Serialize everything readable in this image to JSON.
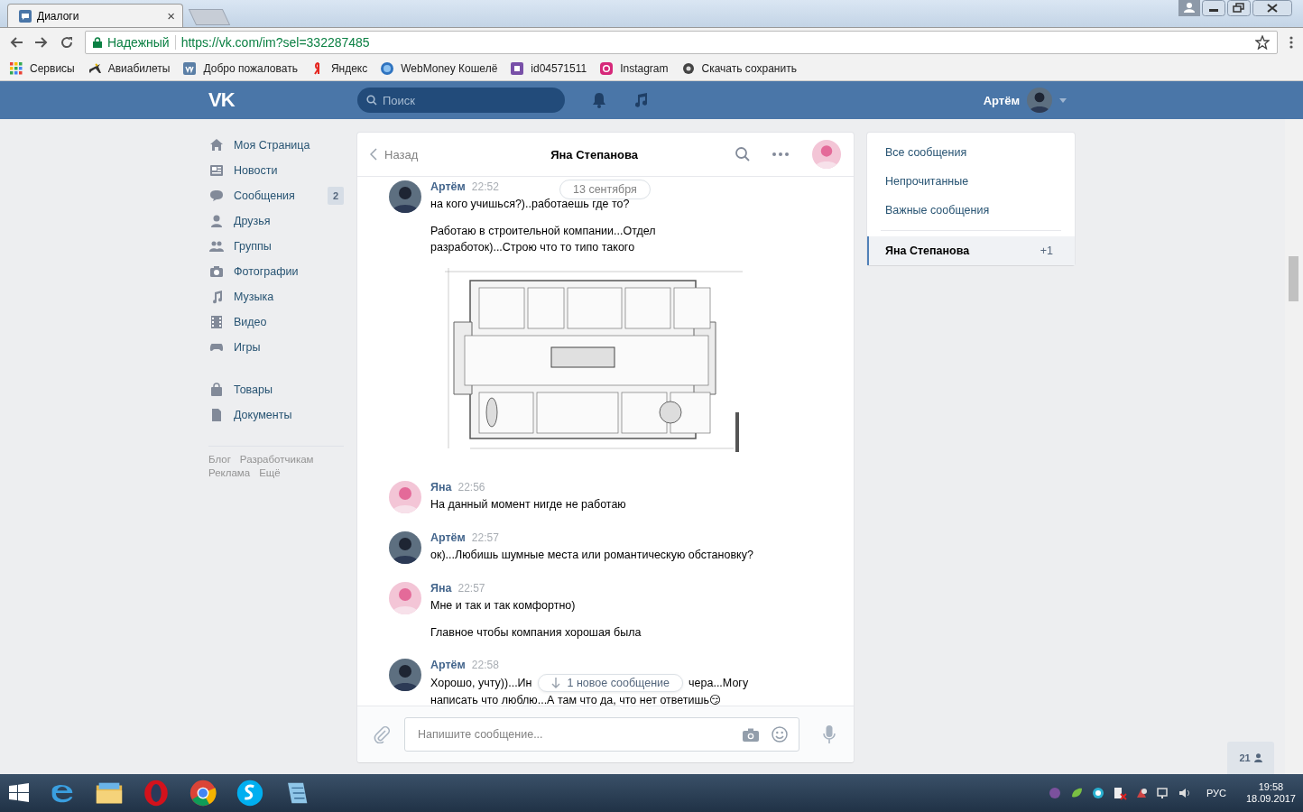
{
  "browser": {
    "tab": {
      "title": "Диалоги",
      "close": "×"
    },
    "security": "Надежный",
    "url": "https://vk.com/im?sel=332287485",
    "bookmarks": [
      {
        "label": "Сервисы"
      },
      {
        "label": "Авиабилеты"
      },
      {
        "label": "Добро пожаловать"
      },
      {
        "label": "Яндекс"
      },
      {
        "label": "WebMoney Кошелё"
      },
      {
        "label": "id04571511"
      },
      {
        "label": "Instagram"
      },
      {
        "label": "Скачать сохранить"
      }
    ]
  },
  "header": {
    "logo": "VK",
    "search_placeholder": "Поиск",
    "user": "Артём"
  },
  "nav": {
    "items": [
      {
        "label": "Моя Страница"
      },
      {
        "label": "Новости"
      },
      {
        "label": "Сообщения",
        "badge": "2"
      },
      {
        "label": "Друзья"
      },
      {
        "label": "Группы"
      },
      {
        "label": "Фотографии"
      },
      {
        "label": "Музыка"
      },
      {
        "label": "Видео"
      },
      {
        "label": "Игры"
      }
    ],
    "extra_items": [
      {
        "label": "Товары"
      },
      {
        "label": "Документы"
      }
    ],
    "footer_links": [
      {
        "label": "Блог"
      },
      {
        "label": "Разработчикам"
      },
      {
        "label": "Реклама"
      },
      {
        "label": "Ещё"
      }
    ]
  },
  "chat": {
    "back": "Назад",
    "title": "Яна Степанова",
    "date": "13 сентября",
    "new_messages": "1 новое сообщение",
    "messages": [
      {
        "kind": "outgoing",
        "author": "Артём",
        "time": "22:52",
        "parts": [
          {
            "kind": "text",
            "text": "на кого учишься?)..работаешь где то?"
          },
          {
            "kind": "text",
            "text": "Работаю в строительной компании...Отдел разработок)...Строю что то типо такого"
          },
          {
            "kind": "picture"
          }
        ]
      },
      {
        "kind": "incoming",
        "author": "Яна",
        "time": "22:56",
        "parts": [
          {
            "kind": "text",
            "text": "На данный момент нигде не работаю"
          }
        ]
      },
      {
        "kind": "outgoing",
        "author": "Артём",
        "time": "22:57",
        "parts": [
          {
            "kind": "text",
            "text": "ок)...Любишь шумные места или романтическую обстановку?"
          }
        ]
      },
      {
        "kind": "incoming",
        "author": "Яна",
        "time": "22:57",
        "parts": [
          {
            "kind": "text",
            "text": "Мне и так и так комфортно)"
          },
          {
            "kind": "text",
            "text": "Главное чтобы компания хорошая была"
          }
        ]
      },
      {
        "kind": "outgoing",
        "author": "Артём",
        "time": "22:58",
        "parts": [
          {
            "kind": "split",
            "before": "Хорошо, учту))...Ин",
            "after": "чера...Могу"
          },
          {
            "kind": "line",
            "text": "написать что люблю...А там что да, что нет ответишь😏"
          }
        ]
      }
    ],
    "composer_placeholder": "Напишите сообщение..."
  },
  "filters": [
    {
      "label": "Все сообщения"
    },
    {
      "label": "Непрочитанные"
    },
    {
      "label": "Важные сообщения"
    }
  ],
  "dialogs": [
    {
      "name": "Яна Степанова",
      "count": "+1",
      "selected": true
    }
  ],
  "online_count": "21",
  "taskbar": {
    "language": "РУС",
    "time": "19:58",
    "date": "18.09.2017"
  }
}
